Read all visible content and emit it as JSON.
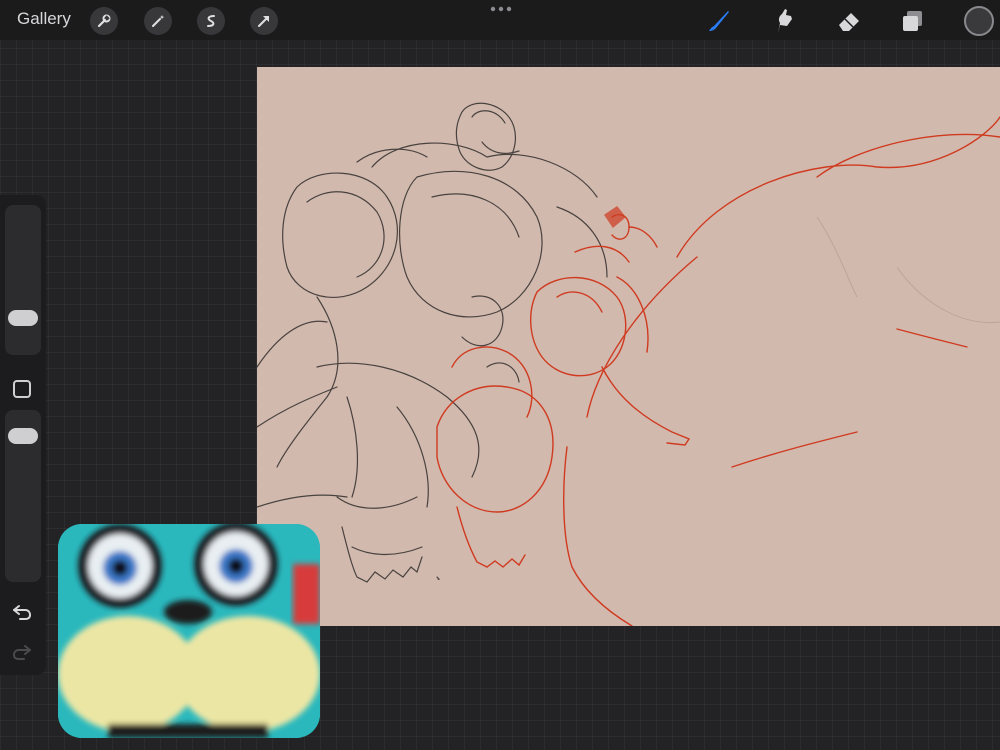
{
  "topbar": {
    "gallery_label": "Gallery",
    "left_tools": [
      "wrench-icon",
      "magic-wand-icon",
      "selection-icon",
      "transform-arrow-icon"
    ],
    "right_tools": [
      "brush-icon",
      "smudge-icon",
      "eraser-icon",
      "layers-icon"
    ],
    "active_tool": "brush-icon",
    "current_color": "#3a3a3c",
    "accent_color": "#2a7cf6"
  },
  "sidebar": {
    "controls": [
      "brush-size-slider",
      "modifier-button",
      "opacity-slider",
      "undo-icon",
      "redo-icon"
    ]
  },
  "canvas": {
    "background_color": "#d2b9ad",
    "stroke_colors": [
      "#3a3634",
      "#cf3a20"
    ]
  },
  "facecam": {
    "description_colors": [
      "#2ab8bd",
      "#efe8a0"
    ]
  }
}
